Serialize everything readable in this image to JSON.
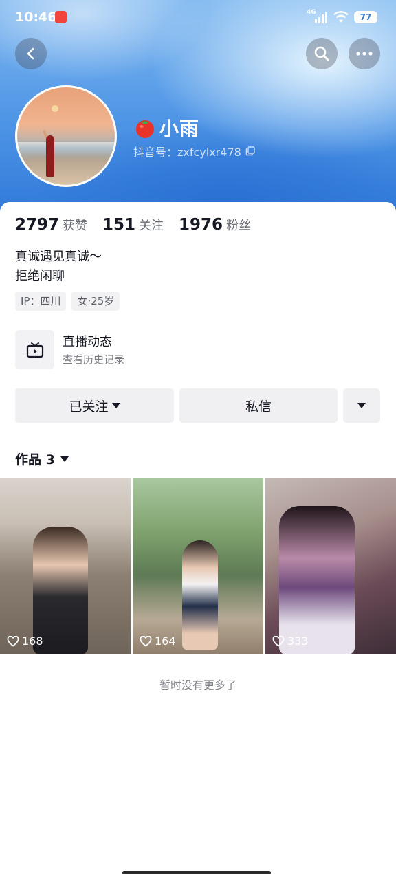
{
  "status_bar": {
    "time": "10:46",
    "app_badge": "a",
    "network": "4G",
    "battery": "77"
  },
  "header": {
    "back_icon": "chevron-left-icon",
    "search_icon": "search-icon",
    "more_icon": "ellipsis-icon"
  },
  "profile": {
    "name_emoji": "tomato-icon",
    "name": "小雨",
    "douyin_id": "抖音号：zxfcylxr478"
  },
  "stats": [
    {
      "value": "2797",
      "label": "获赞"
    },
    {
      "value": "151",
      "label": "关注"
    },
    {
      "value": "1976",
      "label": "粉丝"
    }
  ],
  "bio": {
    "line1": "真诚遇见真诚～",
    "line2": "拒绝闲聊"
  },
  "tags": [
    "IP：四川",
    "女·25岁"
  ],
  "live_entry": {
    "title": "直播动态",
    "subtitle": "查看历史记录"
  },
  "actions": {
    "follow_label": "已关注",
    "message_label": "私信"
  },
  "works": {
    "label": "作品 3",
    "items": [
      {
        "likes": "168"
      },
      {
        "likes": "164"
      },
      {
        "likes": "333"
      }
    ]
  },
  "footer": {
    "no_more_text": "暂时没有更多了"
  },
  "colors": {
    "cover_blue": "#4e95e6",
    "text_primary": "#161823",
    "button_bg": "#f0f0f2"
  }
}
